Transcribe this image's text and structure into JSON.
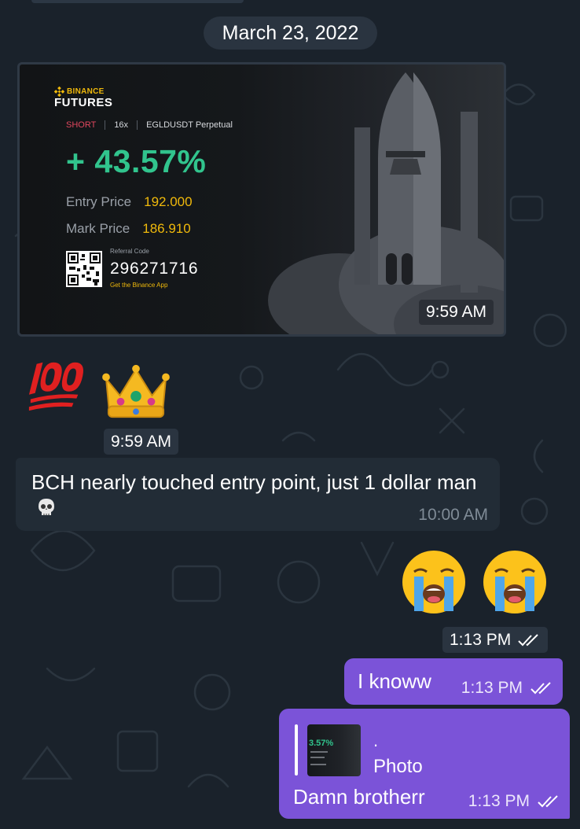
{
  "chat": {
    "date_separator": "March 23, 2022"
  },
  "photo_message": {
    "time": "9:59 AM",
    "card": {
      "brand": "BINANCE",
      "product": "FUTURES",
      "side": "SHORT",
      "leverage": "16x",
      "symbol": "EGLDUSDT Perpetual",
      "pnl": "+ 43.57%",
      "entry_label": "Entry Price",
      "entry_value": "192.000",
      "mark_label": "Mark Price",
      "mark_value": "186.910",
      "referral_label": "Referral Code",
      "referral_code": "296271716",
      "app_cta": "Get the Binance App"
    }
  },
  "emoji_message": {
    "emojis": [
      "hundred-points-icon",
      "crown-icon"
    ],
    "time": "9:59 AM"
  },
  "incoming_text": {
    "text": "BCH nearly touched entry point, just 1 dollar man",
    "emoji": "skull-icon",
    "time": "10:00 AM"
  },
  "crying_message": {
    "emojis": [
      "loudly-crying-face-icon",
      "loudly-crying-face-icon"
    ],
    "time": "1:13 PM"
  },
  "outgoing_1": {
    "text": "I knoww",
    "time": "1:13 PM"
  },
  "outgoing_2": {
    "reply_preview": {
      "title": ".",
      "kind": "Photo",
      "thumb_pnl": "3.57%"
    },
    "text": "Damn brotherr",
    "time": "1:13 PM"
  },
  "colors": {
    "background": "#1a222b",
    "incoming_bubble": "#222c36",
    "outgoing_bubble": "#7b53d8",
    "binance_yellow": "#f0b90b",
    "profit_green": "#31c48d",
    "short_red": "#e0475e"
  }
}
